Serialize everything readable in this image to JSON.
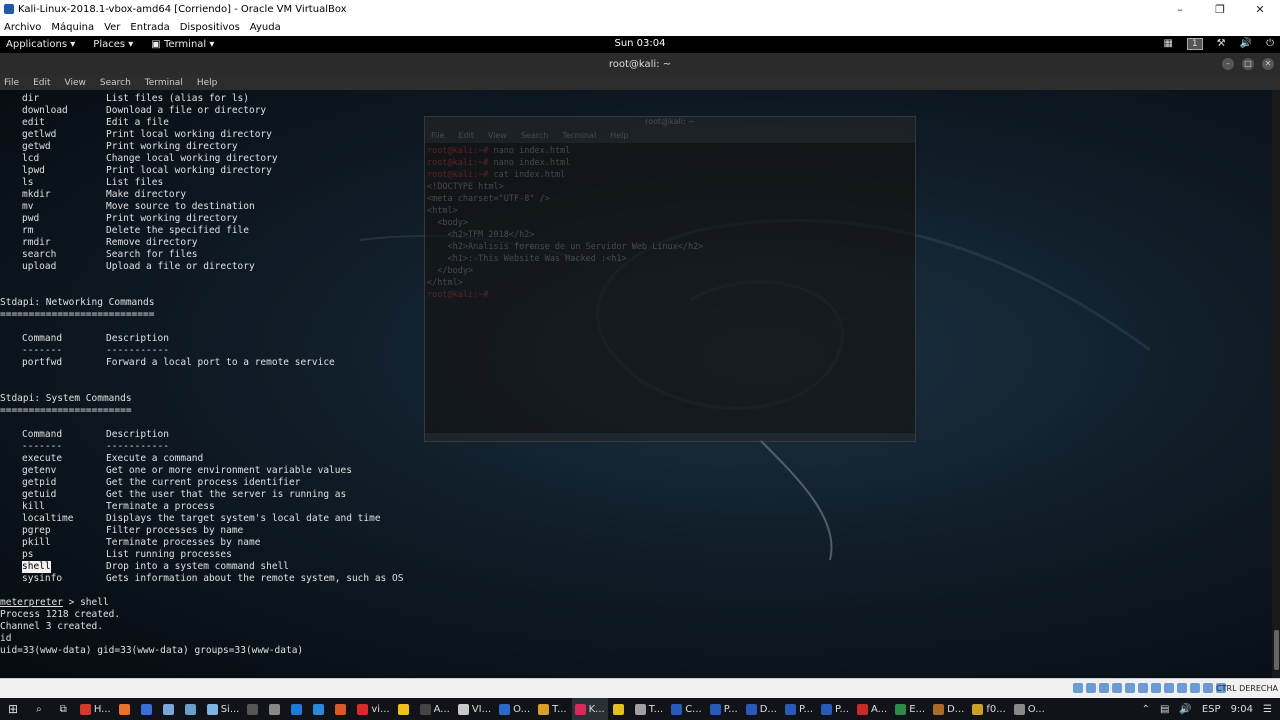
{
  "vbox": {
    "title": "Kali-Linux-2018.1-vbox-amd64 [Corriendo] - Oracle VM VirtualBox",
    "menu": [
      "Archivo",
      "Máquina",
      "Ver",
      "Entrada",
      "Dispositivos",
      "Ayuda"
    ],
    "host_key": "CTRL DERECHA"
  },
  "kali_panel": {
    "applications": "Applications ▾",
    "places": "Places ▾",
    "terminal": "Terminal ▾",
    "clock": "Sun 03:04",
    "workspace": "1"
  },
  "terminal": {
    "title": "root@kali: ~",
    "menu": [
      "File",
      "Edit",
      "View",
      "Search",
      "Terminal",
      "Help"
    ],
    "fs_commands": [
      {
        "cmd": "dir",
        "desc": "List files (alias for ls)"
      },
      {
        "cmd": "download",
        "desc": "Download a file or directory"
      },
      {
        "cmd": "edit",
        "desc": "Edit a file"
      },
      {
        "cmd": "getlwd",
        "desc": "Print local working directory"
      },
      {
        "cmd": "getwd",
        "desc": "Print working directory"
      },
      {
        "cmd": "lcd",
        "desc": "Change local working directory"
      },
      {
        "cmd": "lpwd",
        "desc": "Print local working directory"
      },
      {
        "cmd": "ls",
        "desc": "List files"
      },
      {
        "cmd": "mkdir",
        "desc": "Make directory"
      },
      {
        "cmd": "mv",
        "desc": "Move source to destination"
      },
      {
        "cmd": "pwd",
        "desc": "Print working directory"
      },
      {
        "cmd": "rm",
        "desc": "Delete the specified file"
      },
      {
        "cmd": "rmdir",
        "desc": "Remove directory"
      },
      {
        "cmd": "search",
        "desc": "Search for files"
      },
      {
        "cmd": "upload",
        "desc": "Upload a file or directory"
      }
    ],
    "net_heading": "Stdapi: Networking Commands",
    "net_rule": "===========================",
    "col_command": "Command",
    "col_description": "Description",
    "cmd_dash": "-------",
    "desc_dash": "-----------",
    "net_commands": [
      {
        "cmd": "portfwd",
        "desc": "Forward a local port to a remote service"
      }
    ],
    "sys_heading": "Stdapi: System Commands",
    "sys_rule": "=======================",
    "sys_commands": [
      {
        "cmd": "execute",
        "desc": "Execute a command"
      },
      {
        "cmd": "getenv",
        "desc": "Get one or more environment variable values"
      },
      {
        "cmd": "getpid",
        "desc": "Get the current process identifier"
      },
      {
        "cmd": "getuid",
        "desc": "Get the user that the server is running as"
      },
      {
        "cmd": "kill",
        "desc": "Terminate a process"
      },
      {
        "cmd": "localtime",
        "desc": "Displays the target system's local date and time"
      },
      {
        "cmd": "pgrep",
        "desc": "Filter processes by name"
      },
      {
        "cmd": "pkill",
        "desc": "Terminate processes by name"
      },
      {
        "cmd": "ps",
        "desc": "List running processes"
      },
      {
        "cmd": "shell",
        "desc": "Drop into a system command shell"
      },
      {
        "cmd": "sysinfo",
        "desc": "Gets information about the remote system, such as OS"
      }
    ],
    "prompt": "meterpreter",
    "prompt_cmd": " > shell",
    "out1": "Process 1218 created.",
    "out2": "Channel 3 created.",
    "out3": "id",
    "out4": "uid=33(www-data) gid=33(www-data) groups=33(www-data)"
  },
  "ghost_window": {
    "title": "root@kali: ~",
    "menu": [
      "File",
      "Edit",
      "View",
      "Search",
      "Terminal",
      "Help"
    ],
    "lines": [
      {
        "prompt": "root@kali:~#",
        "text": " nano index.html"
      },
      {
        "prompt": "root@kali:~#",
        "text": " nano index.html"
      },
      {
        "prompt": "root@kali:~#",
        "text": " cat index.html"
      },
      {
        "prompt": "",
        "text": "<!DOCTYPE html>"
      },
      {
        "prompt": "",
        "text": "<meta charset=\"UTF-8\" />"
      },
      {
        "prompt": "",
        "text": "<html>"
      },
      {
        "prompt": "",
        "text": "  <body>"
      },
      {
        "prompt": "",
        "text": "    <h2>TFM 2018</h2>"
      },
      {
        "prompt": "",
        "text": "    <h2>Analisis forense de un Servidor Web Linux</h2>"
      },
      {
        "prompt": "",
        "text": "    <h1>:-This Website Was Hacked :<h1>"
      },
      {
        "prompt": "",
        "text": "  </body>"
      },
      {
        "prompt": "",
        "text": "</html>"
      },
      {
        "prompt": "root@kali:~#",
        "text": " "
      }
    ]
  },
  "taskbar": {
    "items": [
      {
        "label": "H...",
        "color": "#d23a2a"
      },
      {
        "label": "",
        "color": "#e8742a"
      },
      {
        "label": "",
        "color": "#3a6fd8"
      },
      {
        "label": "",
        "color": "#7aa6d8"
      },
      {
        "label": "",
        "color": "#6aa0c8"
      },
      {
        "label": "Si...",
        "color": "#7fb3e0"
      },
      {
        "label": "",
        "color": "#555555"
      },
      {
        "label": "",
        "color": "#888888"
      },
      {
        "label": "",
        "color": "#1e7ad8"
      },
      {
        "label": "",
        "color": "#2a8ad8"
      },
      {
        "label": "",
        "color": "#d85a2a"
      },
      {
        "label": "vi...",
        "color": "#d82a2a"
      },
      {
        "label": "",
        "color": "#f0c020"
      },
      {
        "label": "A...",
        "color": "#444444"
      },
      {
        "label": "VI...",
        "color": "#c8c8c8"
      },
      {
        "label": "O...",
        "color": "#2a6ac8"
      },
      {
        "label": "T...",
        "color": "#d8a02a"
      },
      {
        "label": "K...",
        "color": "#d82a5a"
      },
      {
        "label": "",
        "color": "#e0c020"
      },
      {
        "label": "T...",
        "color": "#a0a0a0"
      },
      {
        "label": "C...",
        "color": "#2a5ab8"
      },
      {
        "label": "P...",
        "color": "#2a5ab8"
      },
      {
        "label": "D...",
        "color": "#2a5ab8"
      },
      {
        "label": "P...",
        "color": "#2a5ab8"
      },
      {
        "label": "P...",
        "color": "#2a5ab8"
      },
      {
        "label": "A...",
        "color": "#c82a2a"
      },
      {
        "label": "E...",
        "color": "#2a8a4a"
      },
      {
        "label": "D...",
        "color": "#aa6a2a"
      },
      {
        "label": "f0...",
        "color": "#c8a02a"
      },
      {
        "label": "O...",
        "color": "#888888"
      }
    ],
    "lang": "ESP",
    "time": "9:04"
  },
  "colors": {
    "terminal_text": "#e0e0e0",
    "ghost_prompt": "#dc3c3c"
  }
}
